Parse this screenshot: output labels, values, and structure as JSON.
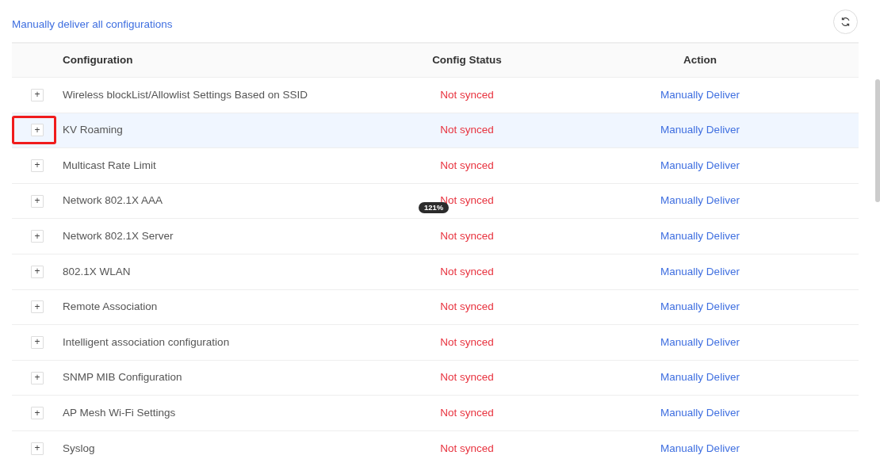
{
  "toolbar": {
    "deliver_all_link": "Manually deliver all configurations"
  },
  "table": {
    "columns": [
      "Configuration",
      "Config Status",
      "Action"
    ],
    "rows": [
      {
        "expander": "+",
        "configuration": "Wireless blockList/Allowlist Settings Based on SSID",
        "status": "Not synced",
        "action": "Manually Deliver",
        "hovered": false,
        "highlighted": false
      },
      {
        "expander": "+",
        "configuration": "KV Roaming",
        "status": "Not synced",
        "action": "Manually Deliver",
        "hovered": true,
        "highlighted": true
      },
      {
        "expander": "+",
        "configuration": "Multicast Rate Limit",
        "status": "Not synced",
        "action": "Manually Deliver",
        "hovered": false,
        "highlighted": false
      },
      {
        "expander": "+",
        "configuration": "Network 802.1X AAA",
        "status": "Not synced",
        "zoom_badge": "121%",
        "action": "Manually Deliver",
        "hovered": false,
        "highlighted": false
      },
      {
        "expander": "+",
        "configuration": "Network 802.1X Server",
        "status": "Not synced",
        "action": "Manually Deliver",
        "hovered": false,
        "highlighted": false
      },
      {
        "expander": "+",
        "configuration": "802.1X WLAN",
        "status": "Not synced",
        "action": "Manually Deliver",
        "hovered": false,
        "highlighted": false
      },
      {
        "expander": "+",
        "configuration": "Remote Association",
        "status": "Not synced",
        "action": "Manually Deliver",
        "hovered": false,
        "highlighted": false
      },
      {
        "expander": "+",
        "configuration": "Intelligent association configuration",
        "status": "Not synced",
        "action": "Manually Deliver",
        "hovered": false,
        "highlighted": false
      },
      {
        "expander": "+",
        "configuration": "SNMP MIB Configuration",
        "status": "Not synced",
        "action": "Manually Deliver",
        "hovered": false,
        "highlighted": false
      },
      {
        "expander": "+",
        "configuration": "AP Mesh Wi-Fi Settings",
        "status": "Not synced",
        "action": "Manually Deliver",
        "hovered": false,
        "highlighted": false
      },
      {
        "expander": "+",
        "configuration": "Syslog",
        "status": "Not synced",
        "action": "Manually Deliver",
        "hovered": false,
        "highlighted": false
      }
    ]
  }
}
